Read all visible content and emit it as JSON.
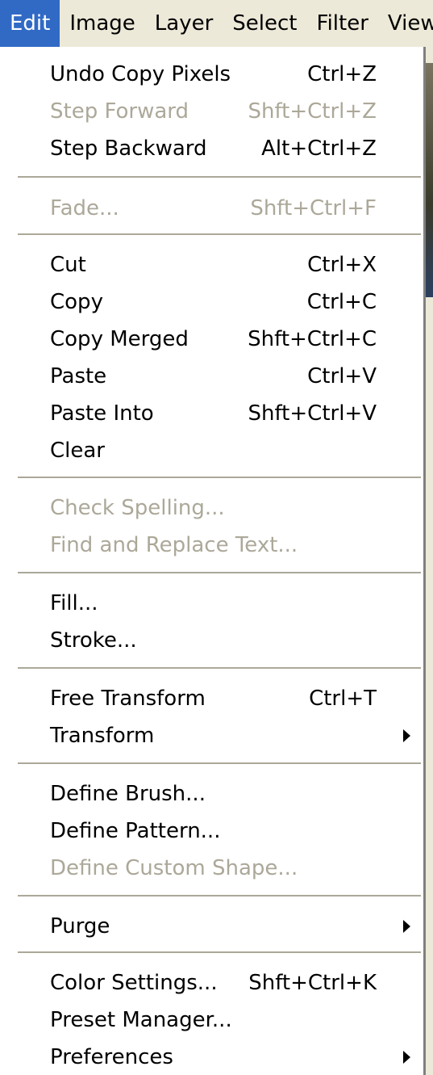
{
  "menubar": {
    "items": [
      {
        "label": "Edit",
        "mnemonic": "E",
        "active": true
      },
      {
        "label": "Image",
        "mnemonic": "I",
        "active": false
      },
      {
        "label": "Layer",
        "mnemonic": "L",
        "active": false
      },
      {
        "label": "Select",
        "mnemonic": "S",
        "active": false
      },
      {
        "label": "Filter",
        "mnemonic": "t",
        "active": false
      },
      {
        "label": "View",
        "mnemonic": "V",
        "active": false
      }
    ]
  },
  "menu": {
    "undo": {
      "label": "Undo Copy Pixels",
      "shortcut": "Ctrl+Z",
      "enabled": true
    },
    "step_forward": {
      "label": "Step Forward",
      "shortcut": "Shft+Ctrl+Z",
      "enabled": false
    },
    "step_backward": {
      "label": "Step Backward",
      "shortcut": "Alt+Ctrl+Z",
      "enabled": true
    },
    "fade": {
      "label": "Fade...",
      "shortcut": "Shft+Ctrl+F",
      "enabled": false
    },
    "cut": {
      "label": "Cut",
      "shortcut": "Ctrl+X",
      "enabled": true
    },
    "copy": {
      "label": "Copy",
      "shortcut": "Ctrl+C",
      "enabled": true
    },
    "copy_merged": {
      "label": "Copy Merged",
      "shortcut": "Shft+Ctrl+C",
      "enabled": true
    },
    "paste": {
      "label": "Paste",
      "shortcut": "Ctrl+V",
      "enabled": true
    },
    "paste_into": {
      "label": "Paste Into",
      "shortcut": "Shft+Ctrl+V",
      "enabled": true
    },
    "clear": {
      "label": "Clear",
      "shortcut": "",
      "enabled": true
    },
    "check_spelling": {
      "label": "Check Spelling...",
      "shortcut": "",
      "enabled": false
    },
    "find_replace": {
      "label": "Find and Replace Text...",
      "shortcut": "",
      "enabled": false
    },
    "fill": {
      "label": "Fill...",
      "shortcut": "",
      "enabled": true
    },
    "stroke": {
      "label": "Stroke...",
      "shortcut": "",
      "enabled": true
    },
    "free_transform": {
      "label": "Free Transform",
      "shortcut": "Ctrl+T",
      "enabled": true
    },
    "transform": {
      "label": "Transform",
      "shortcut": "",
      "enabled": true,
      "submenu": true
    },
    "define_brush": {
      "label": "Define Brush...",
      "shortcut": "",
      "enabled": true
    },
    "define_pattern": {
      "label": "Define Pattern...",
      "shortcut": "",
      "enabled": true
    },
    "define_custom_shape": {
      "label": "Define Custom Shape...",
      "shortcut": "",
      "enabled": false
    },
    "purge": {
      "label": "Purge",
      "shortcut": "",
      "enabled": true,
      "submenu": true
    },
    "color_settings": {
      "label": "Color Settings...",
      "shortcut": "Shft+Ctrl+K",
      "enabled": true
    },
    "preset_manager": {
      "label": "Preset Manager...",
      "shortcut": "",
      "enabled": true
    },
    "preferences": {
      "label": "Preferences",
      "shortcut": "",
      "enabled": true,
      "submenu": true
    }
  },
  "colors": {
    "menubar_bg": "#ece9d8",
    "highlight": "#316ac5",
    "disabled_text": "#aca899",
    "menu_bg": "#ffffff"
  }
}
